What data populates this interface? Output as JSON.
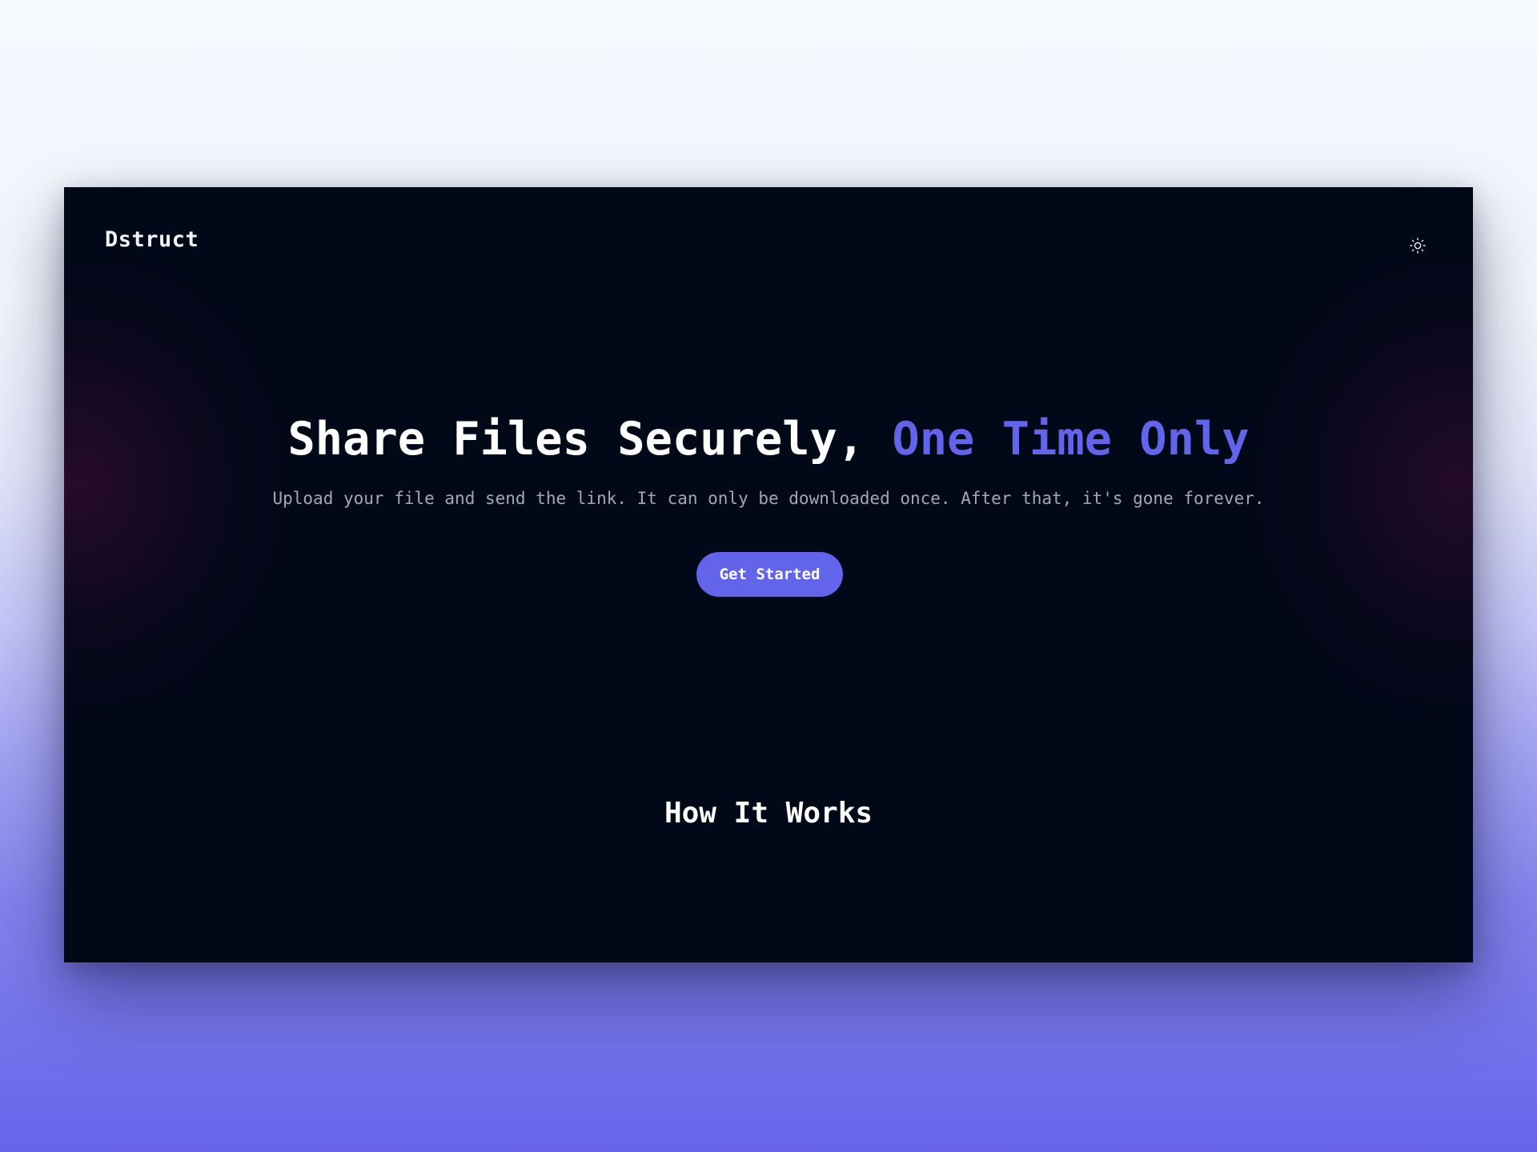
{
  "header": {
    "logo": "Dstruct",
    "theme_toggle_icon": "sun-icon"
  },
  "hero": {
    "title_main": "Share Files Securely, ",
    "title_accent": "One Time Only",
    "subtitle": "Upload your file and send the link. It can only be downloaded once. After that, it's gone forever.",
    "cta_label": "Get Started"
  },
  "how_it_works": {
    "title": "How It Works"
  },
  "colors": {
    "background": "#010818",
    "accent": "#6265ea",
    "subtitle_text": "#a3a8b5",
    "primary_text": "#ffffff"
  }
}
